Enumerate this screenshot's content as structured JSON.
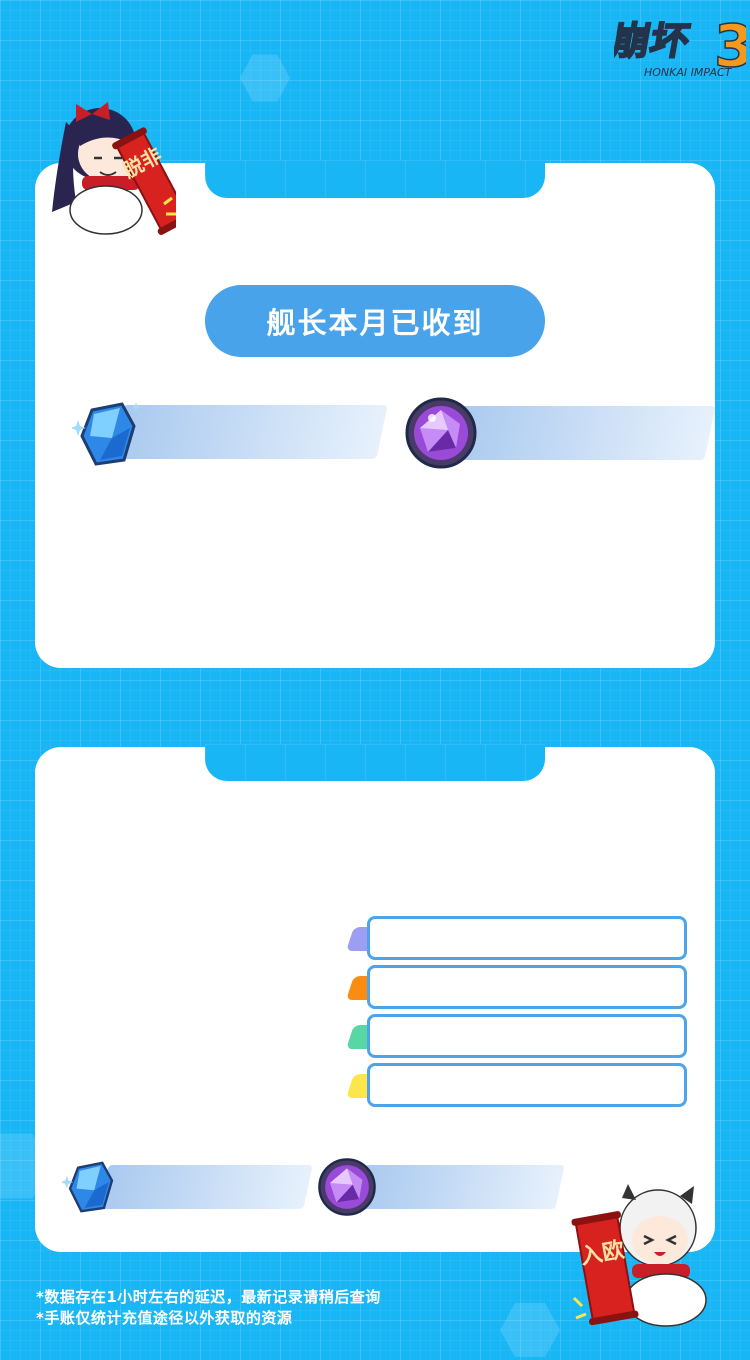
{
  "header": {
    "logo_alt": "HONKAI IMPACT"
  },
  "summary_card": {
    "pill_label": "舰长本月已收到",
    "crystal_icon": "crystal-icon",
    "orb_icon": "stigma-orb-icon"
  },
  "detail_card": {
    "legend_colors": [
      "#9c9ef2",
      "#fb8c12",
      "#58d6a3",
      "#fde64a"
    ]
  },
  "left_chibi_banner": "脱非",
  "right_chibi_banner": "入欧",
  "footnotes": [
    "*数据存在1小时左右的延迟，最新记录请稍后查询",
    "*手账仅统计充值途径以外获取的资源"
  ],
  "colors": {
    "background": "#19b6f6",
    "pill": "#48a3ea",
    "legend_border": "#4da4ea"
  }
}
